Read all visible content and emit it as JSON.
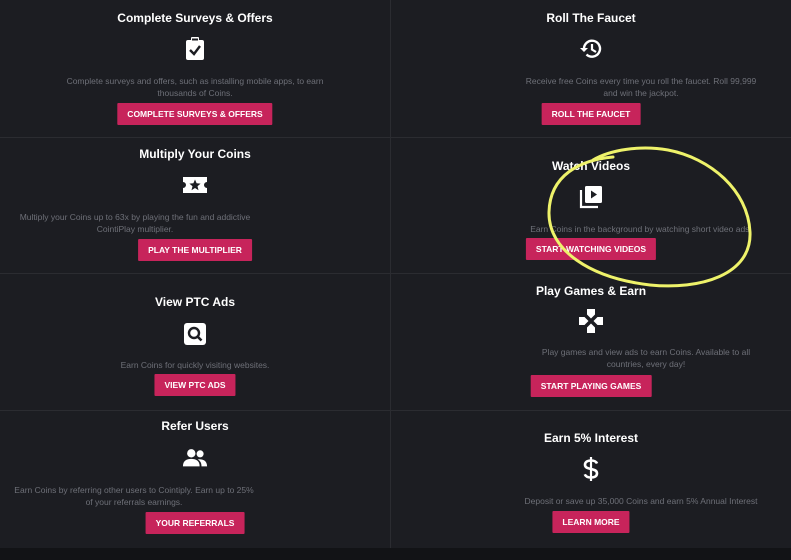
{
  "cards": [
    {
      "title": "Complete Surveys & Offers",
      "icon": "clipboard-check-icon",
      "description": "Complete surveys and offers, such as installing mobile apps, to earn thousands of Coins.",
      "button": "COMPLETE SURVEYS & OFFERS"
    },
    {
      "title": "Roll The Faucet",
      "icon": "history-icon",
      "description": "Receive free Coins every time you roll the faucet. Roll 99,999 and win the jackpot.",
      "button": "ROLL THE FAUCET"
    },
    {
      "title": "Multiply Your Coins",
      "icon": "ticket-star-icon",
      "description": "Multiply your Coins up to 63x by playing the fun and addictive CointiPlay multiplier.",
      "button": "PLAY THE MULTIPLIER"
    },
    {
      "title": "Watch Videos",
      "icon": "video-library-icon",
      "description": "Earn Coins in the background by watching short video ads.",
      "button": "START WATCHING VIDEOS"
    },
    {
      "title": "View PTC Ads",
      "icon": "search-icon",
      "description": "Earn Coins for quickly visiting websites.",
      "button": "VIEW PTC ADS"
    },
    {
      "title": "Play Games & Earn",
      "icon": "gamepad-icon",
      "description": "Play games and view ads to earn Coins. Available to all countries, every day!",
      "button": "START PLAYING GAMES"
    },
    {
      "title": "Refer Users",
      "icon": "people-icon",
      "description": "Earn Coins by referring other users to Cointiply. Earn up to 25% of your referrals earnings.",
      "button": "YOUR REFERRALS"
    },
    {
      "title": "Earn 5% Interest",
      "icon": "dollar-icon",
      "description": "Deposit or save up 35,000 Coins and earn 5% Annual Interest",
      "button": "LEARN MORE"
    }
  ],
  "colors": {
    "background": "#16171b",
    "card": "#1c1d22",
    "button": "#c7245b",
    "annotation": "#eef26a"
  }
}
